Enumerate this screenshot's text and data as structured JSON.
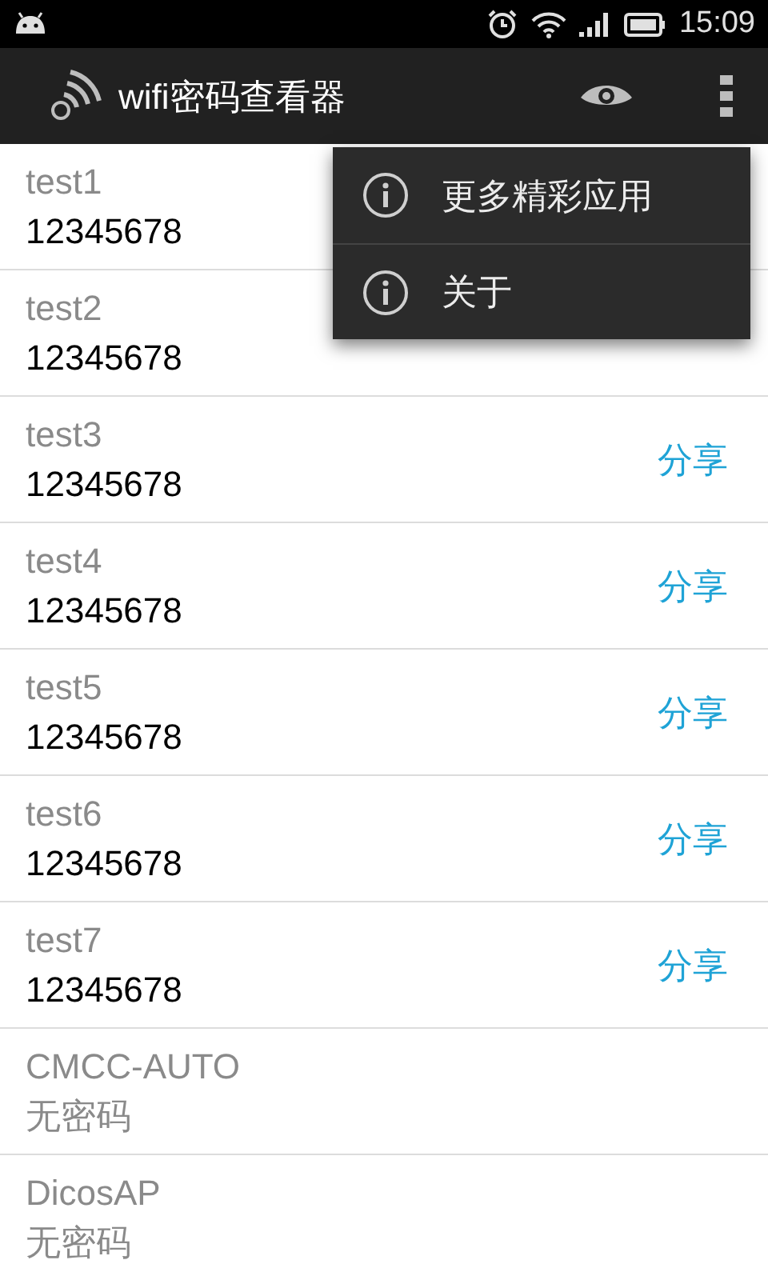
{
  "status_bar": {
    "time": "15:09"
  },
  "action_bar": {
    "title": "wifi密码查看器"
  },
  "networks": [
    {
      "ssid": "test1",
      "password": "12345678",
      "kind": "secured"
    },
    {
      "ssid": "test2",
      "password": "12345678",
      "kind": "secured"
    },
    {
      "ssid": "test3",
      "password": "12345678",
      "kind": "secured",
      "share": "分享"
    },
    {
      "ssid": "test4",
      "password": "12345678",
      "kind": "secured",
      "share": "分享"
    },
    {
      "ssid": "test5",
      "password": "12345678",
      "kind": "secured",
      "share": "分享"
    },
    {
      "ssid": "test6",
      "password": "12345678",
      "kind": "secured",
      "share": "分享"
    },
    {
      "ssid": "test7",
      "password": "12345678",
      "kind": "secured",
      "share": "分享"
    },
    {
      "ssid": "CMCC-AUTO",
      "password": "无密码",
      "kind": "open"
    },
    {
      "ssid": "DicosAP",
      "password": "无密码",
      "kind": "open"
    }
  ],
  "overflow_menu": {
    "items": [
      "更多精彩应用",
      "关于"
    ]
  }
}
